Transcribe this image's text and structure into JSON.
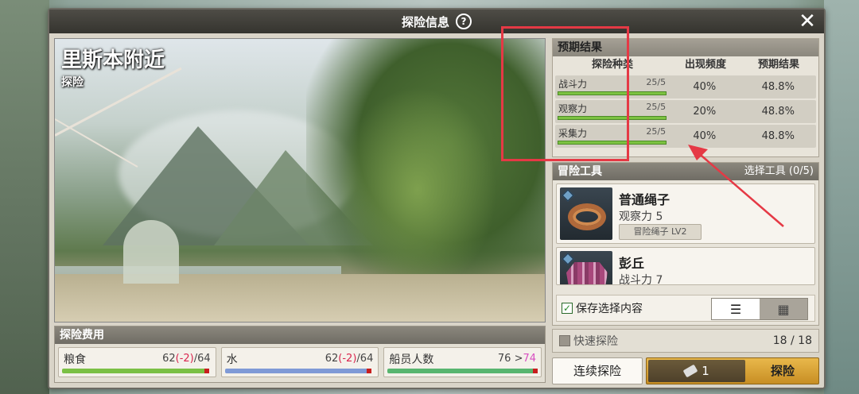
{
  "window": {
    "title": "探险信息"
  },
  "scene": {
    "location": "里斯本附近",
    "type": "探险"
  },
  "cost": {
    "header": "探险费用",
    "items": [
      {
        "label": "粮食",
        "base": "62",
        "delta": "(-2)",
        "sep": "/",
        "max": "64",
        "bar_color": "#7bc045",
        "fill": 0.96
      },
      {
        "label": "水",
        "base": "62",
        "delta": "(-2)",
        "sep": "/",
        "max": "64",
        "bar_color": "#7f9ad6",
        "fill": 0.96
      },
      {
        "label": "船员人数",
        "base": "76 >",
        "delta": "",
        "sep": "",
        "max": "74",
        "bar_color": "#58b56f",
        "fill": 1.0
      }
    ]
  },
  "predict": {
    "header": "预期结果",
    "columns": [
      "探险种类",
      "出现频度",
      "预期结果"
    ],
    "rows": [
      {
        "stat": "战斗力",
        "value": "25/5",
        "freq": "40%",
        "result": "48.8%"
      },
      {
        "stat": "观察力",
        "value": "25/5",
        "freq": "20%",
        "result": "48.8%"
      },
      {
        "stat": "采集力",
        "value": "25/5",
        "freq": "40%",
        "result": "48.8%"
      }
    ]
  },
  "tools": {
    "header": "冒险工具",
    "select": "选择工具 (0/5)",
    "items": [
      {
        "name": "普通绳子",
        "stat": "观察力 5",
        "tag": "冒险绳子 LV2"
      },
      {
        "name": "彭丘",
        "stat": "战斗力 7",
        "tag": ""
      }
    ],
    "save_label": "保存选择内容",
    "view_list": "☰",
    "view_grid": "▦"
  },
  "quick": {
    "label": "快速探险",
    "count": "18 / 18"
  },
  "buttons": {
    "continue": "连续探险",
    "cost": "1",
    "explore": "探险"
  },
  "icons": {
    "help": "?",
    "close": "✕"
  },
  "colors": {
    "highlight": "#e53945",
    "progress": "#7cc241",
    "delta": "#d9264f"
  }
}
